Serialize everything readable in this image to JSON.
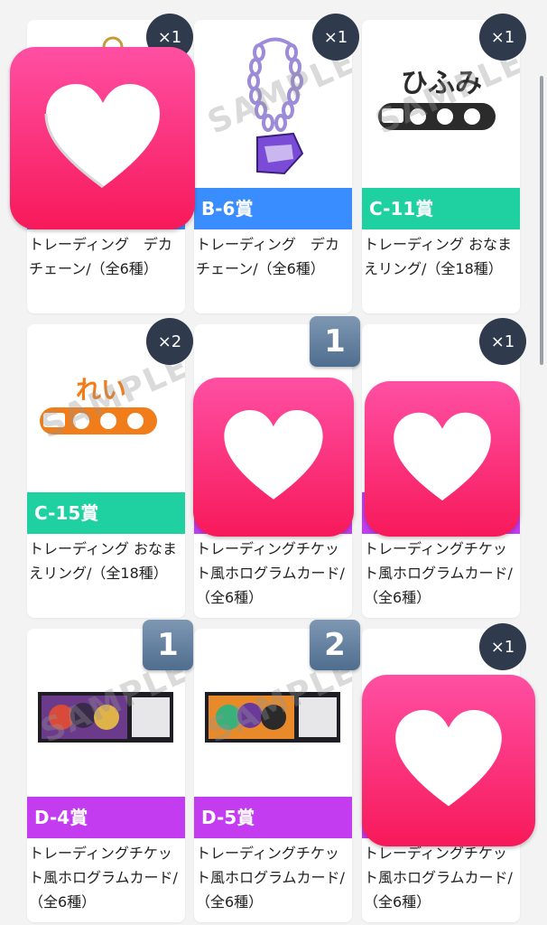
{
  "colors": {
    "blue": "#3a8dff",
    "green": "#1fd1a0",
    "purple": "#c33cf0",
    "heart_pink": "#f7195a"
  },
  "cards": [
    {
      "prize": "",
      "title": "トレーディング　デカチェーン/（全6種）",
      "qty": "×1",
      "color": "blue",
      "watermark": "",
      "item": "keychain"
    },
    {
      "prize": "B-6賞",
      "title": "トレーディング　デカチェーン/（全6種）",
      "qty": "×1",
      "color": "blue",
      "watermark": "SAMPLE",
      "item": "chain"
    },
    {
      "prize": "C-11賞",
      "title": "トレーディング おなまえリング/（全18種）",
      "qty": "×1",
      "color": "green",
      "watermark": "SAMPLE",
      "item": "ring-dark"
    },
    {
      "prize": "C-15賞",
      "title": "トレーディング おなまえリング/（全18種）",
      "qty": "×2",
      "color": "green",
      "watermark": "SAMPLE",
      "item": "ring-orange"
    },
    {
      "prize": "",
      "title": "トレーディングチケット風ホログラムカード/（全6種）",
      "qty": "",
      "color": "purple",
      "watermark": "",
      "item": "hidden"
    },
    {
      "prize": "",
      "title": "トレーディングチケット風ホログラムカード/（全6種）",
      "qty": "×1",
      "color": "purple",
      "watermark": "",
      "item": "hidden"
    },
    {
      "prize": "D-4賞",
      "title": "トレーディングチケット風ホログラムカード/（全6種）",
      "qty": "",
      "color": "purple",
      "watermark": "SAMPLE",
      "item": "ticket1"
    },
    {
      "prize": "D-5賞",
      "title": "トレーディングチケット風ホログラムカード/（全6種）",
      "qty": "",
      "color": "purple",
      "watermark": "SAMPLE",
      "item": "ticket2"
    },
    {
      "prize": "",
      "title": "トレーディングチケット風ホログラムカード/（全6種）",
      "qty": "×1",
      "color": "purple",
      "watermark": "",
      "item": "hidden"
    }
  ],
  "number_badges": [
    "1",
    "1",
    "2"
  ],
  "ring_texts": {
    "dark": "ひふみ",
    "orange": "れい"
  }
}
